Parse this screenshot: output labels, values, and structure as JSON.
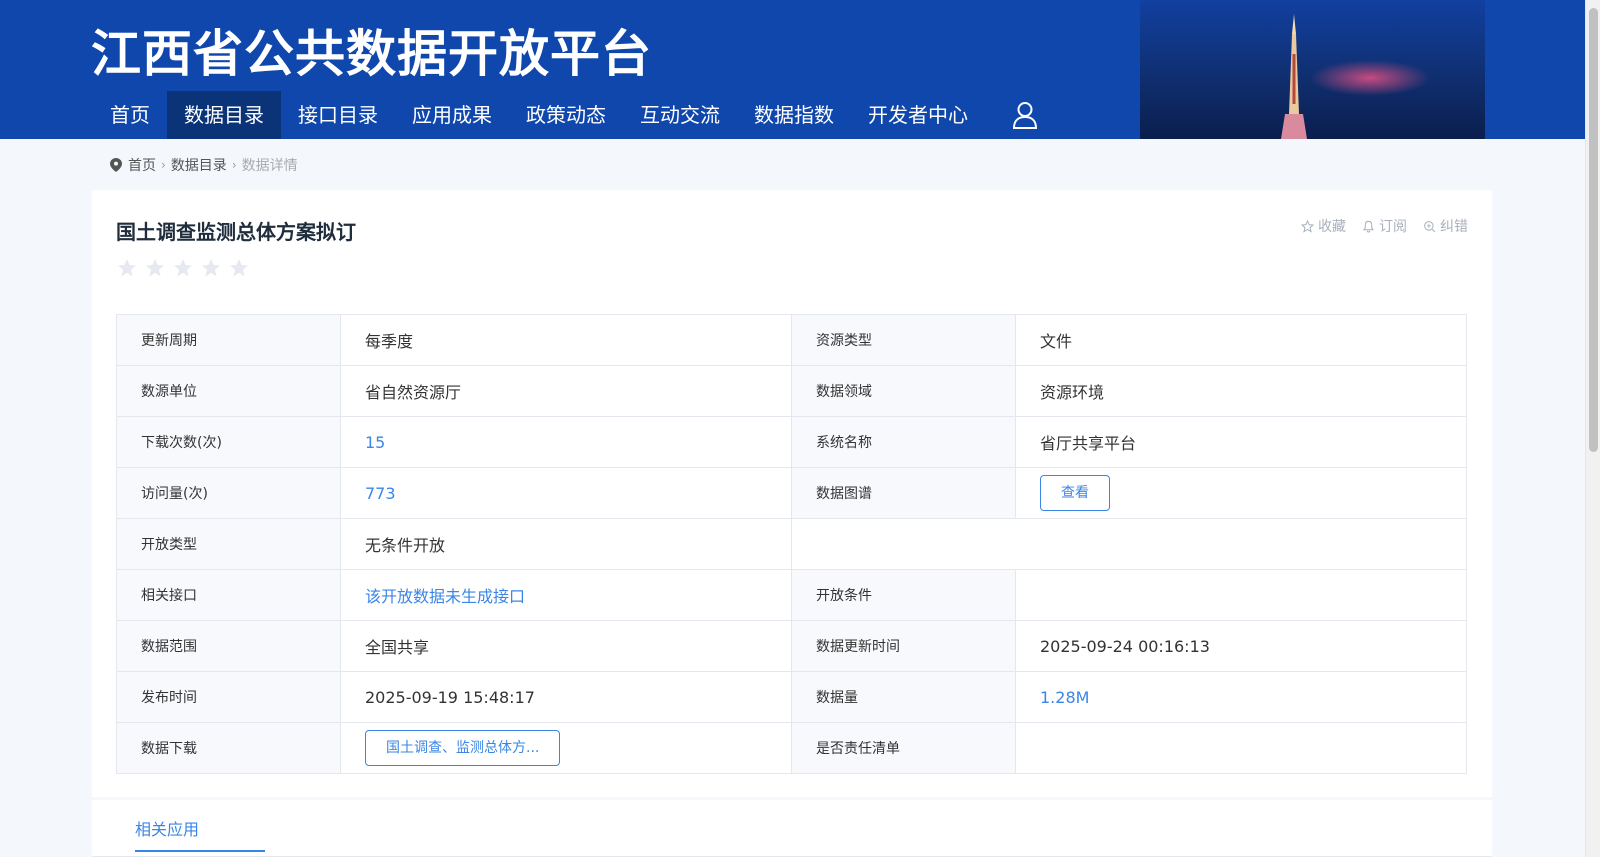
{
  "site": {
    "title": "江西省公共数据开放平台"
  },
  "nav": {
    "items": [
      {
        "label": "首页"
      },
      {
        "label": "数据目录"
      },
      {
        "label": "接口目录"
      },
      {
        "label": "应用成果"
      },
      {
        "label": "政策动态"
      },
      {
        "label": "互动交流"
      },
      {
        "label": "数据指数"
      },
      {
        "label": "开发者中心"
      }
    ],
    "active_index": 1,
    "user_icon": "user-icon"
  },
  "breadcrumb": {
    "items": [
      "首页",
      "数据目录",
      "数据详情"
    ]
  },
  "detail": {
    "title": "国土调查监测总体方案拟订",
    "rating": {
      "value": 0,
      "max": 5
    },
    "actions": [
      {
        "label": "收藏",
        "icon": "star-outline-icon"
      },
      {
        "label": "订阅",
        "icon": "bell-icon"
      },
      {
        "label": "纠错",
        "icon": "magnifier-plus-icon"
      }
    ],
    "fields": {
      "update_cycle": {
        "label": "更新周期",
        "value": "每季度"
      },
      "resource_type": {
        "label": "资源类型",
        "value": "文件"
      },
      "source_unit": {
        "label": "数源单位",
        "value": "省自然资源厅"
      },
      "data_domain": {
        "label": "数据领域",
        "value": "资源环境"
      },
      "downloads": {
        "label": "下载次数(次)",
        "value": "15"
      },
      "system_name": {
        "label": "系统名称",
        "value": "省厅共享平台"
      },
      "visits": {
        "label": "访问量(次)",
        "value": "773"
      },
      "data_graph": {
        "label": "数据图谱",
        "button": "查看"
      },
      "open_type": {
        "label": "开放类型",
        "value": "无条件开放"
      },
      "related_api": {
        "label": "相关接口",
        "value": "该开放数据未生成接口"
      },
      "open_condition": {
        "label": "开放条件",
        "value": ""
      },
      "data_scope": {
        "label": "数据范围",
        "value": "全国共享"
      },
      "update_time": {
        "label": "数据更新时间",
        "value": "2025-09-24 00:16:13"
      },
      "publish_time": {
        "label": "发布时间",
        "value": "2025-09-19 15:48:17"
      },
      "data_size": {
        "label": "数据量",
        "value": "1.28M"
      },
      "download": {
        "label": "数据下载",
        "button": "国土调查、监测总体方..."
      },
      "responsibility_list": {
        "label": "是否责任清单",
        "value": ""
      }
    }
  },
  "tabs": {
    "items": [
      {
        "label": "相关应用"
      }
    ],
    "active_index": 0
  },
  "colors": {
    "header_bg": "#0f47ad",
    "nav_active_bg": "#0b3377",
    "link": "#3a86e6",
    "star": "#e6e9ef"
  }
}
